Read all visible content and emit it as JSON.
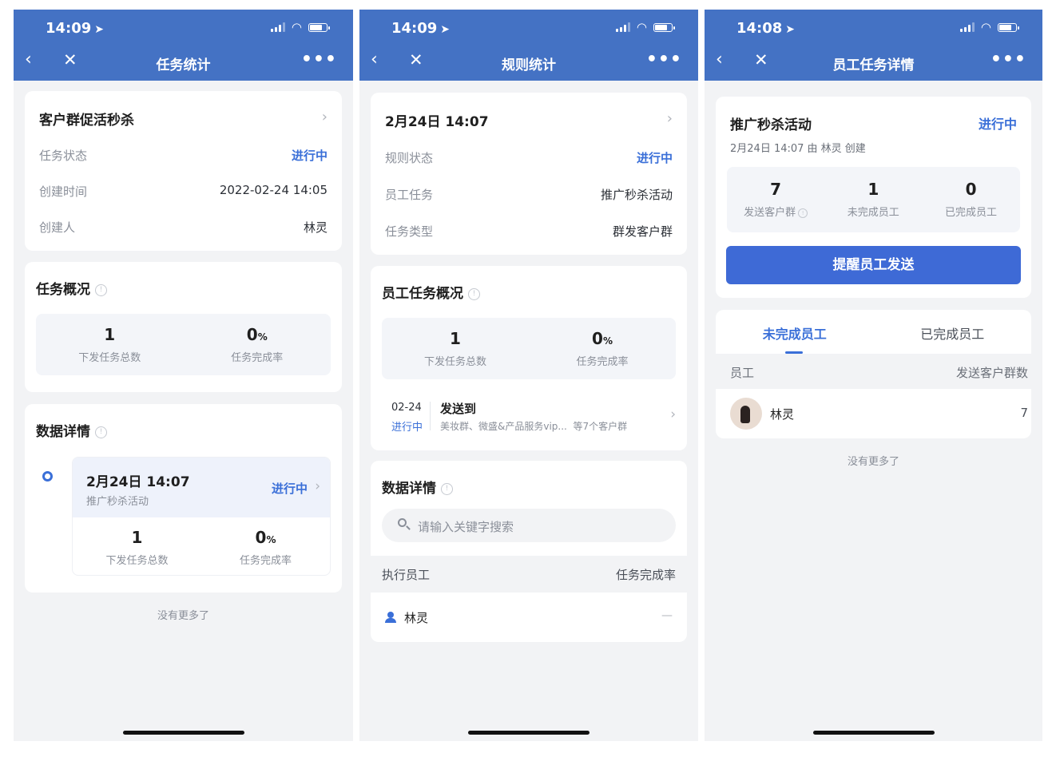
{
  "status": {
    "time_1": "14:09",
    "time_2": "14:09",
    "time_3": "14:08"
  },
  "icons": {
    "back": "chevron-left-icon",
    "close": "close-icon",
    "more": "more-icon",
    "info": "info-icon",
    "chevron": "chevron-right-icon",
    "search": "search-icon",
    "user": "user-icon"
  },
  "colors": {
    "brand": "#4472c4",
    "accent": "#3a6fd8",
    "background": "#f2f3f5"
  },
  "screen1": {
    "nav_title": "任务统计",
    "task_name": "客户群促活秒杀",
    "rows": [
      {
        "label": "任务状态",
        "value": "进行中"
      },
      {
        "label": "创建时间",
        "value": "2022-02-24 14:05"
      },
      {
        "label": "创建人",
        "value": "林灵"
      }
    ],
    "overview_title": "任务概况",
    "overview": {
      "total": "1",
      "total_label": "下发任务总数",
      "rate": "0",
      "rate_unit": "%",
      "rate_label": "任务完成率"
    },
    "details_title": "数据详情",
    "detail_item": {
      "date": "2月24日 14:07",
      "subtitle": "推广秒杀活动",
      "status": "进行中",
      "total": "1",
      "total_label": "下发任务总数",
      "rate": "0",
      "rate_unit": "%",
      "rate_label": "任务完成率"
    },
    "no_more": "没有更多了"
  },
  "screen2": {
    "nav_title": "规则统计",
    "rule_name": "2月24日 14:07",
    "rows": [
      {
        "label": "规则状态",
        "value": "进行中"
      },
      {
        "label": "员工任务",
        "value": "推广秒杀活动"
      },
      {
        "label": "任务类型",
        "value": "群发客户群"
      }
    ],
    "overview_title": "员工任务概况",
    "overview": {
      "total": "1",
      "total_label": "下发任务总数",
      "rate": "0",
      "rate_unit": "%",
      "rate_label": "任务完成率"
    },
    "send": {
      "date": "02-24",
      "status": "进行中",
      "title": "发送到",
      "targets": "美妆群、微盛&产品服务vip...",
      "count": "等7个客户群"
    },
    "details_title": "数据详情",
    "search_placeholder": "请输入关键字搜索",
    "table_headers": [
      "执行员工",
      "任务完成率"
    ],
    "rows_table": [
      {
        "name": "林灵",
        "rate": "—"
      }
    ]
  },
  "screen3": {
    "nav_title": "员工任务详情",
    "task_name": "推广秒杀活动",
    "status": "进行中",
    "meta": "2月24日 14:07 由 林灵 创建",
    "stats": [
      {
        "num": "7",
        "label": "发送客户群"
      },
      {
        "num": "1",
        "label": "未完成员工"
      },
      {
        "num": "0",
        "label": "已完成员工"
      }
    ],
    "remind_button": "提醒员工发送",
    "tabs": [
      "未完成员工",
      "已完成员工"
    ],
    "table_headers": [
      "员工",
      "发送客户群数"
    ],
    "rows_table": [
      {
        "name": "林灵",
        "count": "7"
      }
    ],
    "no_more": "没有更多了"
  }
}
